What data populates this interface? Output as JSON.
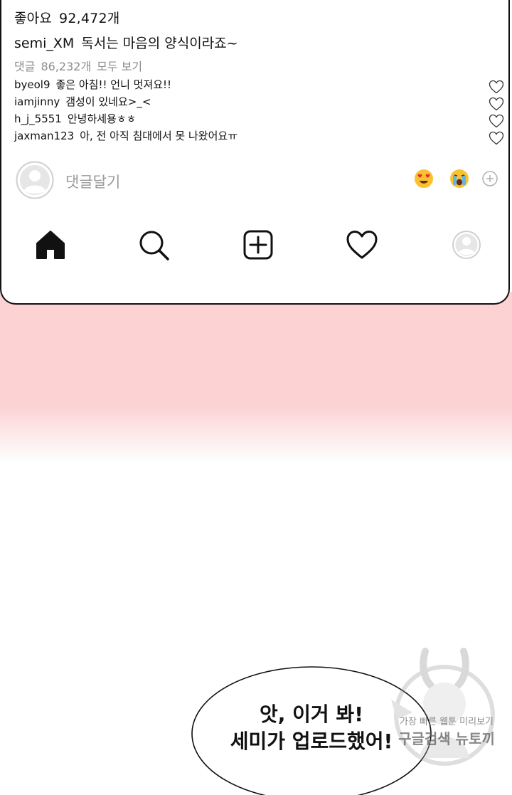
{
  "post": {
    "likes_label": "좋아요",
    "likes_count": "92,472개",
    "author": "semi_XM",
    "caption": "독서는 마음의 양식이라죠~",
    "comments_label": "댓글",
    "comments_count": "86,232개",
    "view_all": "모두 보기"
  },
  "comments": [
    {
      "user": "byeol9",
      "text": "좋은 아침!! 언니 멋져요!!",
      "like_icon": "heart-outline"
    },
    {
      "user": "iamjinny",
      "text": "갬성이 있네요>_<",
      "like_icon": "heart-outline"
    },
    {
      "user": "h_j_5551",
      "text": "안녕하세용ㅎㅎ",
      "like_icon": "heart-outline"
    },
    {
      "user": "jaxman123",
      "text": "아, 전 아직 침대에서 못 나왔어요ㅠ",
      "like_icon": "heart-outline"
    }
  ],
  "add_comment": {
    "placeholder": "댓글달기",
    "emoji_1": "heart-eyes-emoji",
    "emoji_2": "crying-emoji",
    "more_icon": "plus-circle-icon"
  },
  "tabbar": {
    "items": [
      "home-icon",
      "search-icon",
      "add-post-icon",
      "activity-heart-icon",
      "profile-avatar-icon"
    ]
  },
  "speech": {
    "line1": "앗, 이거 봐!",
    "line2": "세미가 업로드했어!"
  },
  "watermark": {
    "line1": "가장 빠른 웹툰 미리보기",
    "line2": "구글검색 뉴토끼"
  },
  "colors": {
    "pink_band": "#fcd2d3",
    "muted_text": "#8d8d8d",
    "outline": "#111111"
  }
}
